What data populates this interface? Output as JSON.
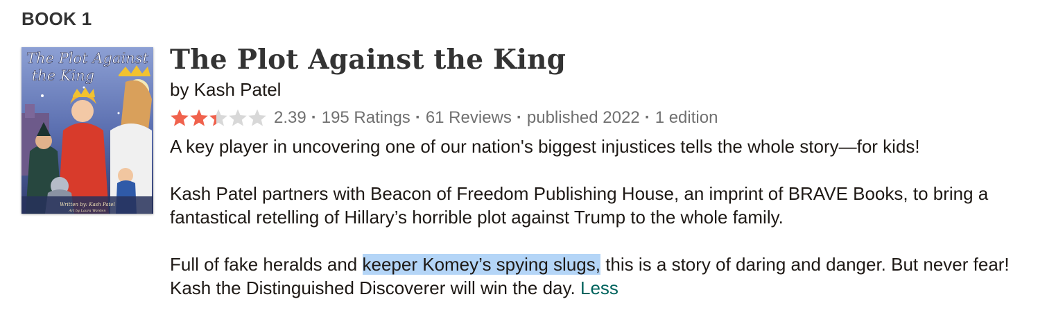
{
  "section_label": "BOOK 1",
  "book": {
    "title": "The Plot Against the King",
    "author_line": "by Kash Patel",
    "cover_text": "The Plot Against the King",
    "rating": 2.39,
    "rating_text": "2.39",
    "max_rating": 5,
    "ratings_text": "195 Ratings",
    "reviews_text": "61 Reviews",
    "published_text": "published 2022",
    "editions_text": "1 edition",
    "meta_separator": "·",
    "description": {
      "para1": "A key player in uncovering one of our nation's biggest injustices tells the whole story—for kids!",
      "para2": "Kash Patel partners with Beacon of Freedom Publishing House, an imprint of BRAVE Books, to bring a fantastical retelling of Hillary’s horrible plot against Trump to the whole family.",
      "para3_before": "Full of fake heralds and ",
      "para3_highlight": "keeper Komey’s spying slugs,",
      "para3_after": " this is a story of daring and danger. But never fear! Kash the Distinguished Discoverer will win the day. ",
      "less_link": "Less"
    }
  },
  "colors": {
    "star_filled": "#f0624d",
    "star_empty": "#d8d8d8",
    "link": "#00635d",
    "highlight": "#b4d5f7"
  }
}
